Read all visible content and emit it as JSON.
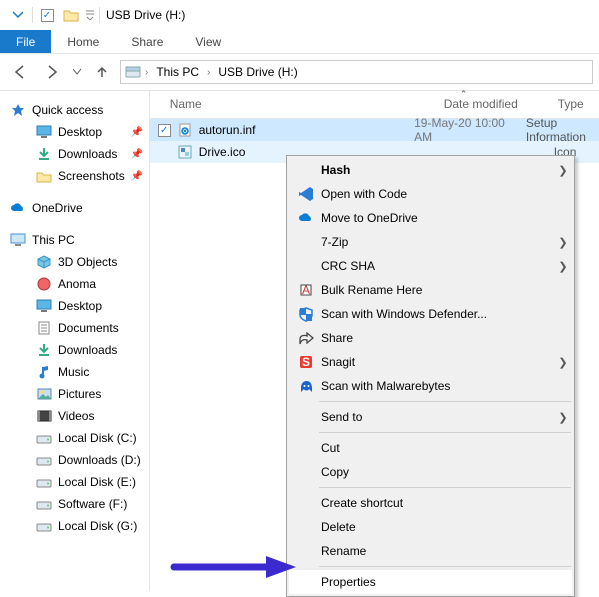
{
  "title": "USB Drive (H:)",
  "ribbon": {
    "file": "File",
    "home": "Home",
    "share": "Share",
    "view": "View"
  },
  "breadcrumb": {
    "root": "This PC",
    "current": "USB Drive (H:)"
  },
  "columns": {
    "name": "Name",
    "date": "Date modified",
    "type": "Type"
  },
  "sidebar": {
    "quick_access": {
      "label": "Quick access",
      "items": [
        {
          "label": "Desktop",
          "pinned": true
        },
        {
          "label": "Downloads",
          "pinned": true
        },
        {
          "label": "Screenshots",
          "pinned": true
        }
      ]
    },
    "onedrive": {
      "label": "OneDrive"
    },
    "this_pc": {
      "label": "This PC",
      "items": [
        {
          "label": "3D Objects"
        },
        {
          "label": "Anoma"
        },
        {
          "label": "Desktop"
        },
        {
          "label": "Documents"
        },
        {
          "label": "Downloads"
        },
        {
          "label": "Music"
        },
        {
          "label": "Pictures"
        },
        {
          "label": "Videos"
        },
        {
          "label": "Local Disk (C:)"
        },
        {
          "label": "Downloads  (D:)"
        },
        {
          "label": "Local Disk (E:)"
        },
        {
          "label": "Software (F:)"
        },
        {
          "label": "Local Disk (G:)"
        }
      ]
    }
  },
  "files": [
    {
      "name": "autorun.inf",
      "date": "19-May-20 10:00 AM",
      "type": "Setup Information",
      "selected": true
    },
    {
      "name": "Drive.ico",
      "date": "",
      "type": "Icon",
      "selected": true
    }
  ],
  "context_menu": [
    {
      "label": "Hash",
      "bold": true,
      "submenu": true,
      "icon": ""
    },
    {
      "label": "Open with Code",
      "icon": "vscode"
    },
    {
      "label": "Move to OneDrive",
      "icon": "onedrive"
    },
    {
      "label": "7-Zip",
      "submenu": true
    },
    {
      "label": "CRC SHA",
      "submenu": true
    },
    {
      "label": "Bulk Rename Here",
      "icon": "bulk"
    },
    {
      "label": "Scan with Windows Defender...",
      "icon": "defender"
    },
    {
      "label": "Share",
      "icon": "share"
    },
    {
      "label": "Snagit",
      "submenu": true,
      "icon": "snagit"
    },
    {
      "label": "Scan with Malwarebytes",
      "icon": "mbam"
    },
    {
      "sep": true
    },
    {
      "label": "Send to",
      "submenu": true
    },
    {
      "sep": true
    },
    {
      "label": "Cut"
    },
    {
      "label": "Copy"
    },
    {
      "sep": true
    },
    {
      "label": "Create shortcut"
    },
    {
      "label": "Delete"
    },
    {
      "label": "Rename"
    },
    {
      "sep": true
    },
    {
      "label": "Properties",
      "highlight": true
    }
  ]
}
